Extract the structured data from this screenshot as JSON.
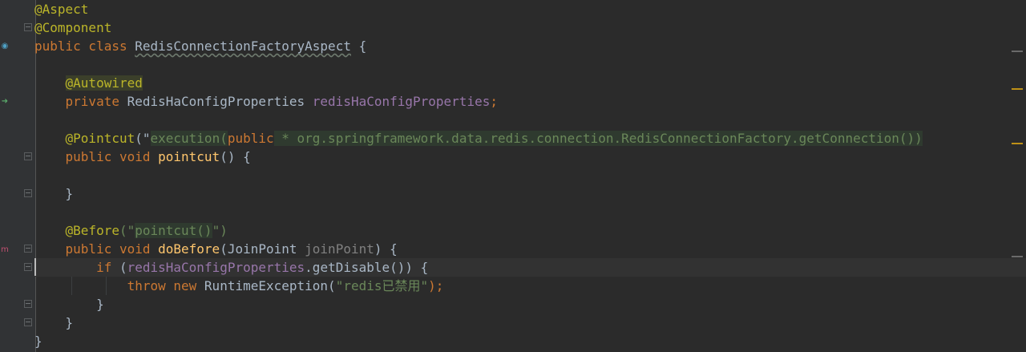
{
  "editor": {
    "lines": [
      {
        "tokens": [
          {
            "t": "@Aspect",
            "c": "ann"
          }
        ]
      },
      {
        "tokens": [
          {
            "t": "@Component",
            "c": "ann"
          }
        ]
      },
      {
        "tokens": [
          {
            "t": "public class ",
            "c": "kw"
          },
          {
            "t": "RedisConnectionFactoryAspect",
            "c": "squiggle"
          },
          {
            "t": " {",
            "c": ""
          }
        ]
      },
      {
        "tokens": []
      },
      {
        "tokens": [
          {
            "t": "    ",
            "c": ""
          },
          {
            "t": "@Autowired",
            "c": "ann-hl"
          }
        ]
      },
      {
        "tokens": [
          {
            "t": "    ",
            "c": ""
          },
          {
            "t": "private ",
            "c": "kw"
          },
          {
            "t": "RedisHaConfigProperties ",
            "c": ""
          },
          {
            "t": "redisHaConfigProperties",
            "c": "fld"
          },
          {
            "t": ";",
            "c": "kw"
          }
        ]
      },
      {
        "tokens": []
      },
      {
        "tokens": [
          {
            "t": "    ",
            "c": ""
          },
          {
            "t": "@Pointcut",
            "c": "ann"
          },
          {
            "t": "(\"",
            "c": ""
          },
          {
            "t": "execution(",
            "c": "str-hl"
          },
          {
            "t": "public",
            "c": "kw"
          },
          {
            "t": " * org.springframework.data.redis.connection.RedisConnectionFactory.getConnection())",
            "c": "str-hl"
          }
        ]
      },
      {
        "tokens": [
          {
            "t": "    ",
            "c": ""
          },
          {
            "t": "public void ",
            "c": "kw"
          },
          {
            "t": "pointcut",
            "c": "fn"
          },
          {
            "t": "() {",
            "c": ""
          }
        ]
      },
      {
        "tokens": []
      },
      {
        "tokens": [
          {
            "t": "    }",
            "c": ""
          }
        ]
      },
      {
        "tokens": []
      },
      {
        "tokens": [
          {
            "t": "    ",
            "c": ""
          },
          {
            "t": "@Before",
            "c": "ann"
          },
          {
            "t": "(\"",
            "c": "str"
          },
          {
            "t": "pointcut()",
            "c": "str-hl"
          },
          {
            "t": "\")",
            "c": "str"
          }
        ]
      },
      {
        "tokens": [
          {
            "t": "    ",
            "c": ""
          },
          {
            "t": "public void ",
            "c": "kw"
          },
          {
            "t": "doBefore",
            "c": "fn"
          },
          {
            "t": "(JoinPoint ",
            "c": ""
          },
          {
            "t": "joinPoint",
            "c": "unused"
          },
          {
            "t": ") {",
            "c": ""
          }
        ]
      },
      {
        "tokens": [
          {
            "t": "        ",
            "c": ""
          },
          {
            "t": "if ",
            "c": "kw"
          },
          {
            "t": "(",
            "c": ""
          },
          {
            "t": "redisHaConfigProperties",
            "c": "fld"
          },
          {
            "t": ".getDisable()) {",
            "c": ""
          }
        ]
      },
      {
        "tokens": [
          {
            "t": "            ",
            "c": ""
          },
          {
            "t": "throw new ",
            "c": "kw"
          },
          {
            "t": "RuntimeException(",
            "c": ""
          },
          {
            "t": "\"redis已禁用\"",
            "c": "str"
          },
          {
            "t": ");",
            "c": "kw"
          }
        ]
      },
      {
        "tokens": [
          {
            "t": "        }",
            "c": ""
          }
        ]
      },
      {
        "tokens": [
          {
            "t": "    }",
            "c": ""
          }
        ]
      },
      {
        "tokens": [
          {
            "t": "}",
            "c": ""
          }
        ]
      }
    ]
  },
  "colors": {
    "background": "#2b2b2b",
    "gutter": "#313335",
    "keyword": "#cc7832",
    "annotation": "#bbb529",
    "field": "#9876aa",
    "method": "#ffc66d",
    "string": "#6a8759"
  },
  "gutter_icons": [
    {
      "name": "spring-bean-icon",
      "glyph": "◉",
      "color": "#4ea0c4"
    },
    {
      "name": "autowired-navigation-icon",
      "glyph": "➜",
      "color": "#59a869"
    },
    {
      "name": "advice-method-icon",
      "glyph": "m",
      "color": "#c05070"
    }
  ]
}
